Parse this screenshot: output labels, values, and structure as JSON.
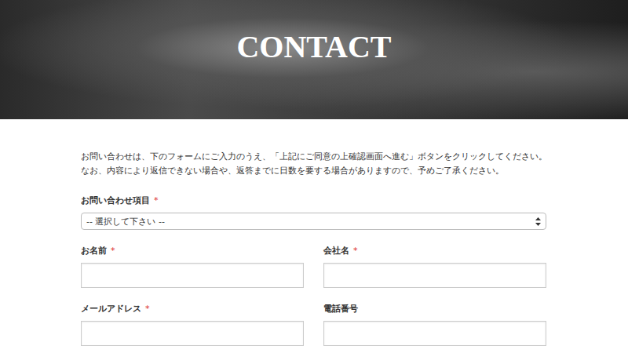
{
  "hero": {
    "title": "CONTACT"
  },
  "intro": [
    "お問い合わせは、下のフォームにご入力のうえ、「上記にご同意の上確認画面へ進む」ボタンをクリックしてください。",
    "なお、内容により返信できない場合や、返答までに日数を要する場合がありますので、予めご了承ください。"
  ],
  "required_mark": "*",
  "fields": [
    {
      "label": "お問い合わせ項目",
      "required": true,
      "kind": "select",
      "placeholder": "-- 選択して下さい --"
    },
    {
      "label": "お名前",
      "required": true,
      "kind": "text",
      "placeholder": ""
    },
    {
      "label": "会社名",
      "required": true,
      "kind": "text",
      "placeholder": ""
    },
    {
      "label": "メールアドレス",
      "required": true,
      "kind": "text",
      "placeholder": ""
    },
    {
      "label": "電話番号",
      "required": false,
      "kind": "text",
      "placeholder": ""
    }
  ]
}
